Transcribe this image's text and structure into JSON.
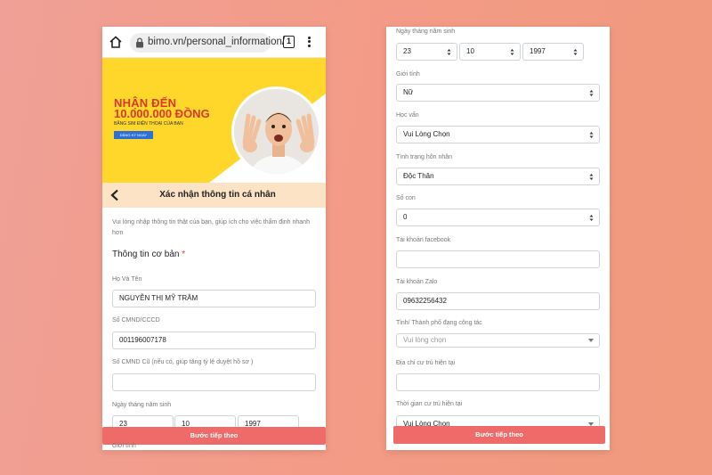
{
  "browser": {
    "url": "bimo.vn/personal_information/",
    "tab_count": "1"
  },
  "banner": {
    "line1": "NHẬN ĐẾN",
    "line2": "10.000.000 ĐỒNG",
    "line3": "BẰNG SIM ĐIỆN THOẠI CỦA BẠN",
    "cta": "ĐĂNG KÝ NGAY"
  },
  "header": {
    "title": "Xác nhận thông tin cá nhân"
  },
  "note": "Vui lòng nhập thông tin thật của bạn, giúp ích cho việc thẩm định nhanh hơn",
  "section": {
    "title": "Thông tin cơ bản",
    "required_mark": "*"
  },
  "left_form": {
    "name_label": "Họ Và Tên",
    "name_value": "NGUYỄN THỊ MỸ TRÂM",
    "id_label": "Số CMND/CCCD",
    "id_value": "001196007178",
    "old_id_label": "Số CMND Cũ (nếu có, giúp tăng tỷ lệ duyệt hồ sơ )",
    "old_id_value": "",
    "dob_label": "Ngày tháng năm sinh",
    "dob_day": "23",
    "dob_month": "10",
    "dob_year": "1997",
    "gender_label": "Giới tính"
  },
  "right_form": {
    "dob_label": "Ngày tháng năm sinh",
    "dob_day": "23",
    "dob_month": "10",
    "dob_year": "1997",
    "gender_label": "Giới tính",
    "gender_value": "Nữ",
    "education_label": "Học vấn",
    "education_value": "Vui Lòng Chọn",
    "marital_label": "Tình trạng hôn nhân",
    "marital_value": "Độc Thân",
    "children_label": "Số con",
    "children_value": "0",
    "facebook_label": "Tài khoản facebook",
    "facebook_value": "",
    "zalo_label": "Tài khoản Zalo",
    "zalo_value": "09632256432",
    "city_label": "Tỉnh/ Thành phố đang công tác",
    "city_placeholder": "Vui lòng chọn",
    "address_label": "Địa chỉ cư trú hiện tại",
    "address_value": "",
    "residence_time_label": "Thời gian cư trú hiện tại",
    "residence_time_value": "Vui Lòng Chọn"
  },
  "buttons": {
    "next": "Bước tiếp theo"
  },
  "colors": {
    "banner_yellow": "#ffd62a",
    "header_bg": "#fde3c6",
    "button": "#ee6b6a",
    "accent_red": "#d83a2a"
  }
}
